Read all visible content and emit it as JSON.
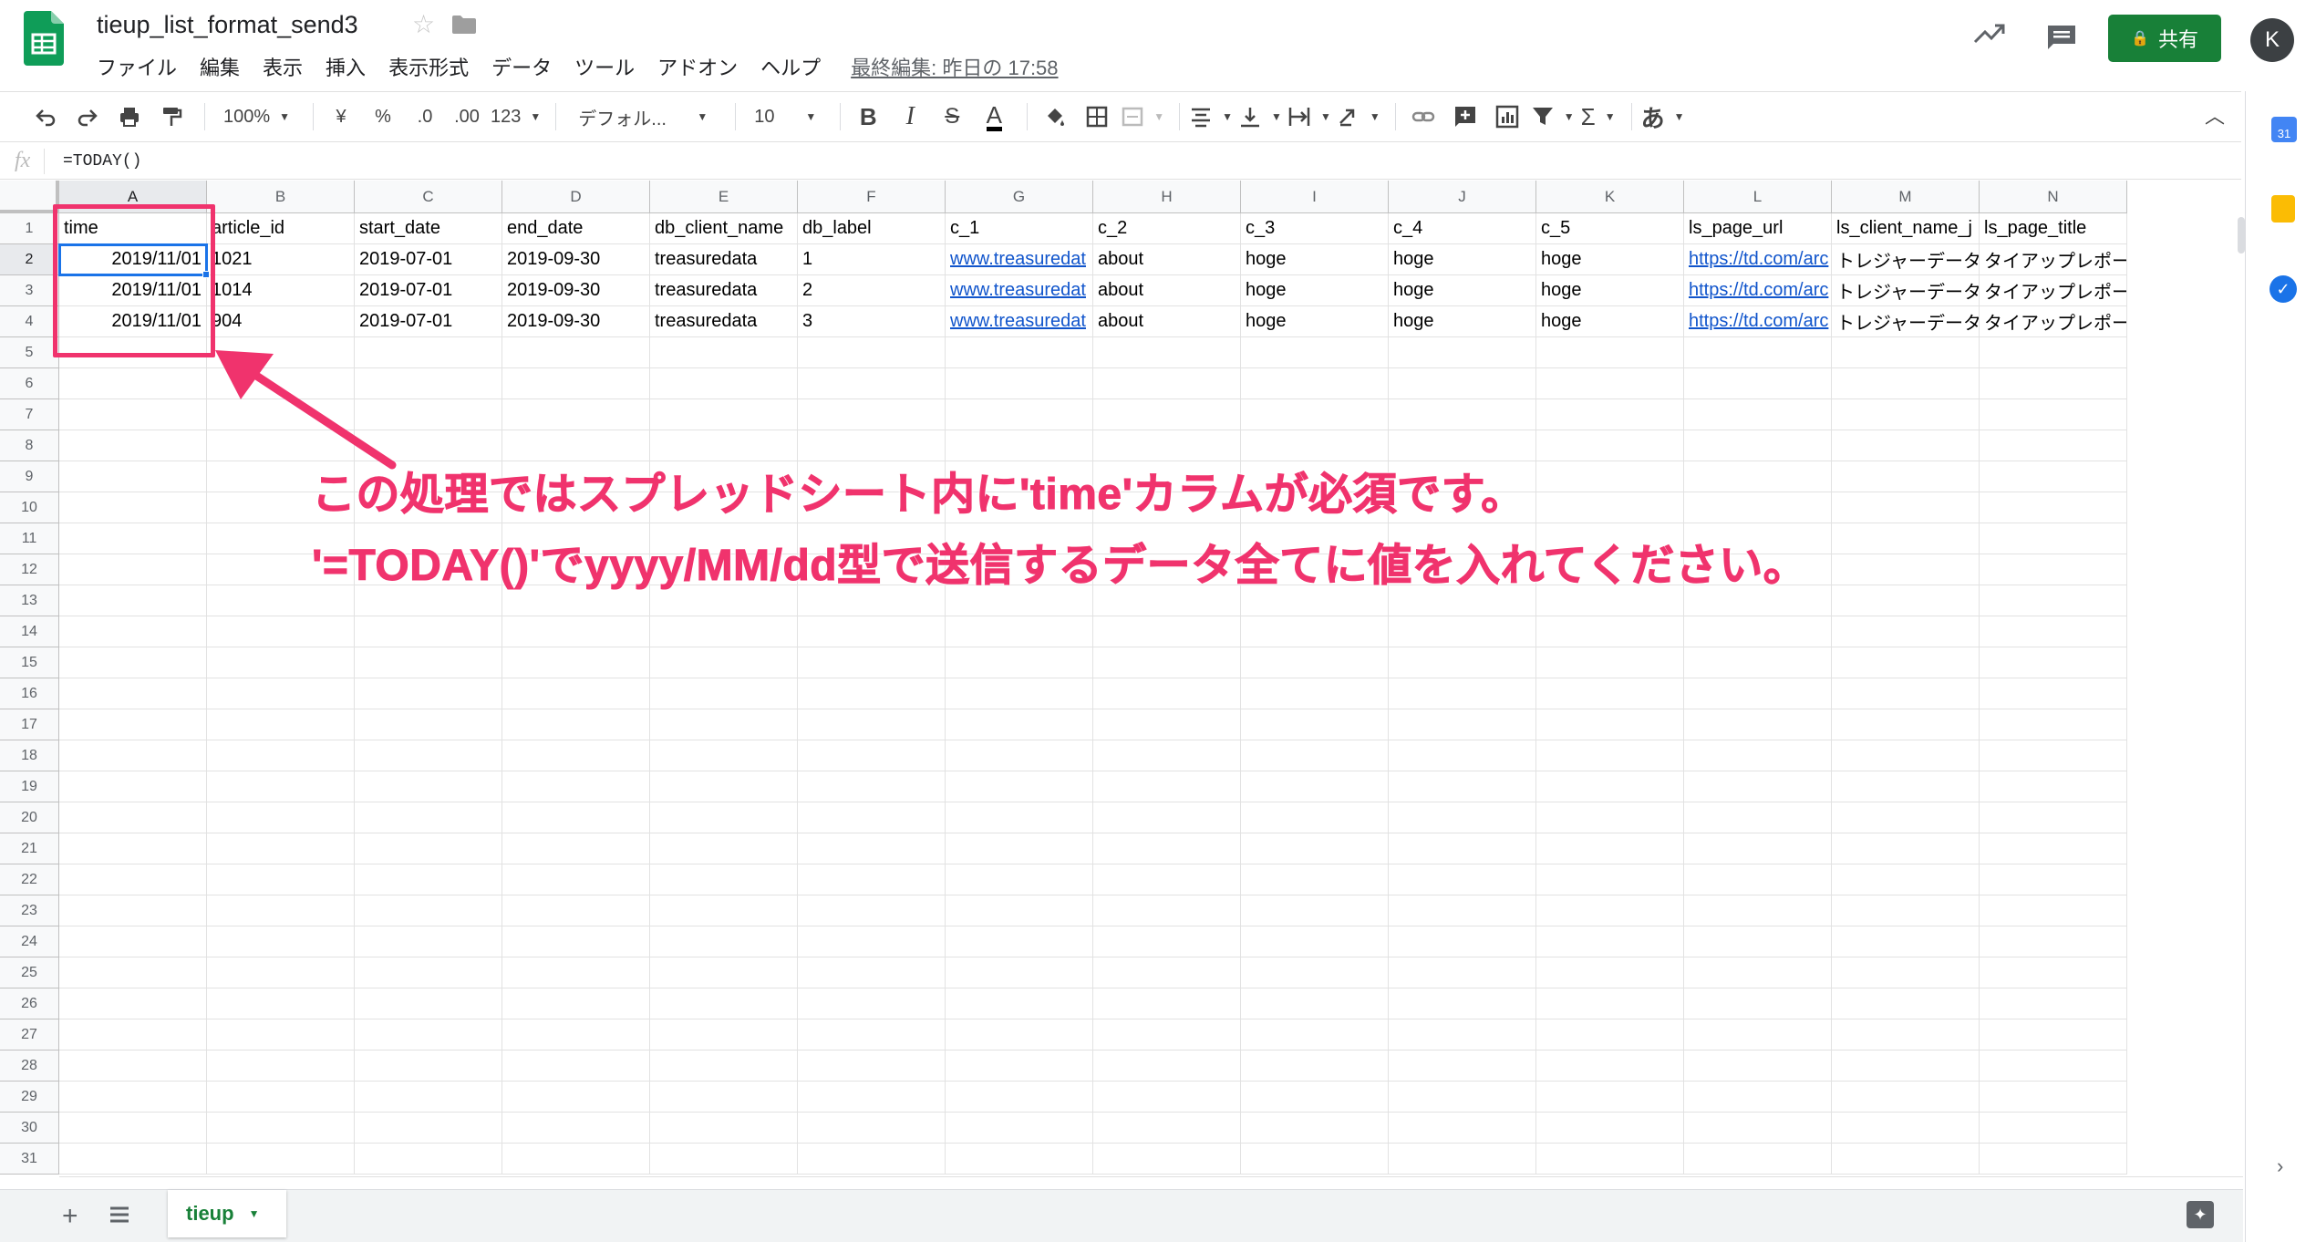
{
  "header": {
    "doc_title": "tieup_list_format_send3",
    "menu": [
      "ファイル",
      "編集",
      "表示",
      "挿入",
      "表示形式",
      "データ",
      "ツール",
      "アドオン",
      "ヘルプ"
    ],
    "last_edit": "最終編集: 昨日の 17:58",
    "share_label": "共有",
    "avatar_initial": "K"
  },
  "toolbar": {
    "zoom": "100%",
    "currency": "¥",
    "percent": "%",
    "decrease_decimal": ".0",
    "increase_decimal": ".00",
    "number_format": "123",
    "font": "デフォル...",
    "font_size": "10",
    "bold": "B",
    "italic": "I",
    "strikethrough": "S",
    "text_color": "A",
    "sum": "Σ",
    "input_tools": "あ"
  },
  "formula_bar": {
    "fx": "fx",
    "formula": "=TODAY()"
  },
  "grid": {
    "columns": [
      "A",
      "B",
      "C",
      "D",
      "E",
      "F",
      "G",
      "H",
      "I",
      "J",
      "K",
      "L",
      "M",
      "N"
    ],
    "row_numbers": [
      "1",
      "2",
      "3",
      "4",
      "5",
      "6",
      "7",
      "8",
      "9",
      "10",
      "11",
      "12",
      "13",
      "14",
      "15",
      "16",
      "17",
      "18",
      "19",
      "20",
      "21",
      "22",
      "23",
      "24",
      "25",
      "26",
      "27",
      "28",
      "29",
      "30",
      "31"
    ],
    "rows": [
      [
        "time",
        "article_id",
        "start_date",
        "end_date",
        "db_client_name",
        "db_label",
        "c_1",
        "c_2",
        "c_3",
        "c_4",
        "c_5",
        "ls_page_url",
        "ls_client_name_j",
        "ls_page_title"
      ],
      [
        "2019/11/01",
        "1021",
        "2019-07-01",
        "2019-09-30",
        "treasuredata",
        "1",
        "www.treasuredat",
        "about",
        "hoge",
        "hoge",
        "hoge",
        "https://td.com/arc",
        "トレジャーデータ",
        "タイアップレポー"
      ],
      [
        "2019/11/01",
        "1014",
        "2019-07-01",
        "2019-09-30",
        "treasuredata",
        "2",
        "www.treasuredat",
        "about",
        "hoge",
        "hoge",
        "hoge",
        "https://td.com/arc",
        "トレジャーデータ",
        "タイアップレポー"
      ],
      [
        "2019/11/01",
        "904",
        "2019-07-01",
        "2019-09-30",
        "treasuredata",
        "3",
        "www.treasuredat",
        "about",
        "hoge",
        "hoge",
        "hoge",
        "https://td.com/arc",
        "トレジャーデータ",
        "タイアップレポー"
      ]
    ],
    "link_columns": [
      6,
      11
    ],
    "numeric_right_columns": [
      0
    ],
    "active_cell": "A2"
  },
  "annotation": {
    "line1": "この処理ではスプレッドシート内に'time'カラムが必須です。",
    "line2": "'=TODAY()'でyyyy/MM/dd型で送信するデータ全てに値を入れてください。",
    "color": "#f0336d"
  },
  "sheets": {
    "tabs": [
      "tieup"
    ],
    "add_label": "+"
  },
  "side_panel": {
    "calendar_day": "31"
  },
  "colors": {
    "brand_green": "#188038",
    "link_blue": "#1155cc",
    "selection_blue": "#1a73e8"
  }
}
